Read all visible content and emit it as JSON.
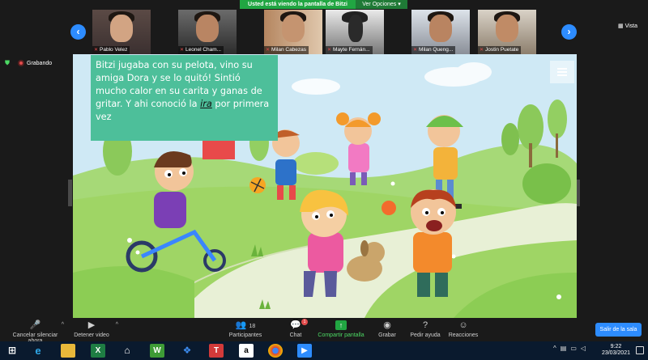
{
  "banner": {
    "status": "Usted está viendo la pantalla de Bitzi",
    "options": "Ver Opciones",
    "options_caret": "▾"
  },
  "participants": [
    {
      "name": "Pablo Velez"
    },
    {
      "name": "Leonel Cham..."
    },
    {
      "name": "Milan Cabezas"
    },
    {
      "name": "Mayte Fernán..."
    },
    {
      "name": "Milan Queng..."
    },
    {
      "name": "Jostin Puetate"
    }
  ],
  "view": {
    "label": "Vista"
  },
  "recording": {
    "label": "Grabando"
  },
  "slide": {
    "caption_before": "Bitzi jugaba con su pelota, vino su amiga Dora y se lo quitó! Sintió mucho calor en su carita y ganas de gritar. Y ahi conoció la ",
    "caption_emph": "ira",
    "caption_after": " por primera vez"
  },
  "toolbar": {
    "mute": "Cancelar silenciar ahora",
    "video": "Detener video",
    "participants": "Participantes",
    "participants_count": "18",
    "chat": "Chat",
    "chat_badge": "1",
    "share": "Compartir pantalla",
    "record": "Grabar",
    "help": "Pedir ayuda",
    "reactions": "Reacciones",
    "leave": "Salir de la sala"
  },
  "taskbar": {
    "time": "9:22",
    "date": "23/03/2021",
    "apps": [
      "windows-start",
      "internet-explorer",
      "file-explorer",
      "excel",
      "store",
      "wps-writer",
      "dropbox",
      "t-app",
      "amazon",
      "chrome",
      "zoom"
    ]
  },
  "colors": {
    "zoom_blue": "#2d8cff",
    "share_green": "#21a642",
    "caption_green": "#4dbf9a",
    "record_red": "#e24c4c"
  }
}
